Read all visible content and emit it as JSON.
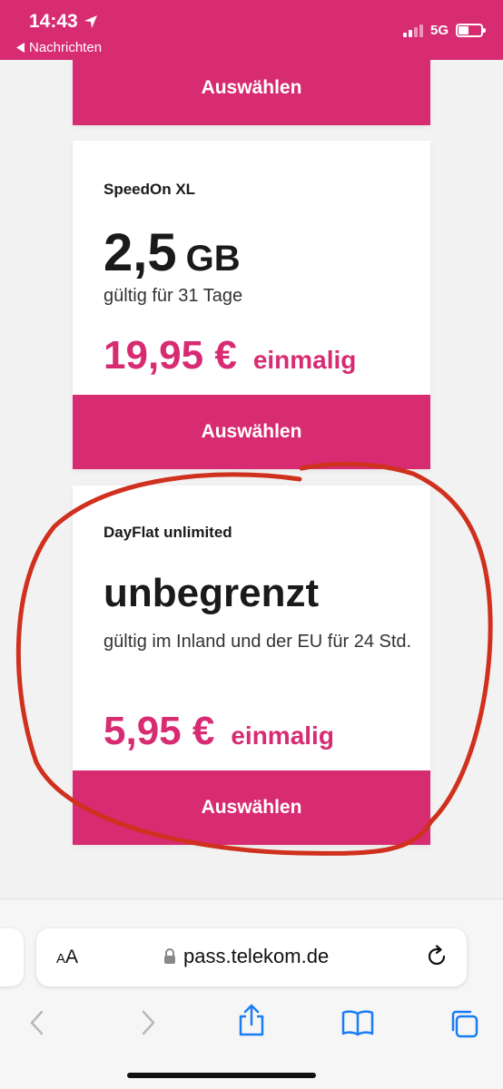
{
  "status_bar": {
    "time": "14:43",
    "back_label": "Nachrichten",
    "network": "5G"
  },
  "plans": [
    {
      "select_label": "Auswählen"
    },
    {
      "name": "SpeedOn XL",
      "volume_number": "2,5",
      "volume_unit": "GB",
      "validity": "gültig für 31 Tage",
      "price": "19,95 €",
      "price_note": "einmalig",
      "select_label": "Auswählen"
    },
    {
      "name": "DayFlat unlimited",
      "volume": "unbegrenzt",
      "validity": "gültig im Inland und der EU für 24 Std.",
      "price": "5,95 €",
      "price_note": "einmalig",
      "select_label": "Auswählen"
    }
  ],
  "browser": {
    "text_size_label_small": "A",
    "text_size_label_large": "A",
    "url": "pass.telekom.de"
  },
  "colors": {
    "brand": "#d72b72",
    "annotation": "#d0301e"
  },
  "icons": [
    "location-arrow-icon",
    "back-triangle-icon",
    "signal-icon",
    "battery-icon",
    "lock-icon",
    "reload-icon",
    "back-arrow-icon",
    "forward-arrow-icon",
    "share-icon",
    "bookmarks-icon",
    "tabs-icon"
  ]
}
